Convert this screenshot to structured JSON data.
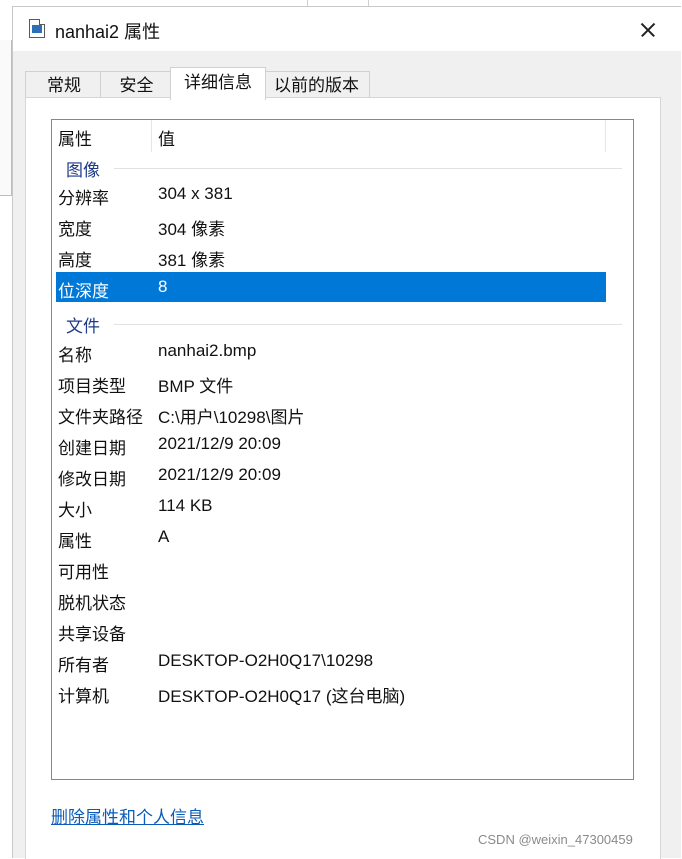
{
  "window": {
    "title": "nanhai2 属性",
    "title_icon": "bitmap-file-icon",
    "close_icon": "close-icon"
  },
  "tabs": [
    {
      "label": "常规"
    },
    {
      "label": "安全"
    },
    {
      "label": "详细信息",
      "active": true
    },
    {
      "label": "以前的版本"
    }
  ],
  "details": {
    "columns": {
      "property": "属性",
      "value": "值"
    },
    "groups": [
      {
        "label": "图像",
        "rows": [
          {
            "key": "分辨率",
            "value": "304 x 381"
          },
          {
            "key": "宽度",
            "value": "304 像素"
          },
          {
            "key": "高度",
            "value": "381 像素"
          },
          {
            "key": "位深度",
            "value": "8",
            "selected": true
          }
        ]
      },
      {
        "label": "文件",
        "rows": [
          {
            "key": "名称",
            "value": "nanhai2.bmp"
          },
          {
            "key": "项目类型",
            "value": "BMP 文件"
          },
          {
            "key": "文件夹路径",
            "value": "C:\\用户\\10298\\图片"
          },
          {
            "key": "创建日期",
            "value": "2021/12/9 20:09"
          },
          {
            "key": "修改日期",
            "value": "2021/12/9 20:09"
          },
          {
            "key": "大小",
            "value": "114 KB"
          },
          {
            "key": "属性",
            "value": "A"
          },
          {
            "key": "可用性",
            "value": ""
          },
          {
            "key": "脱机状态",
            "value": ""
          },
          {
            "key": "共享设备",
            "value": ""
          },
          {
            "key": "所有者",
            "value": "DESKTOP-O2H0Q17\\10298"
          },
          {
            "key": "计算机",
            "value": "DESKTOP-O2H0Q17 (这台电脑)"
          }
        ]
      }
    ]
  },
  "remove_link": "删除属性和个人信息",
  "watermark": "CSDN @weixin_47300459",
  "colors": {
    "selection": "#0078d7",
    "group_label": "#1e3a8a",
    "link": "#0b5cb8"
  }
}
